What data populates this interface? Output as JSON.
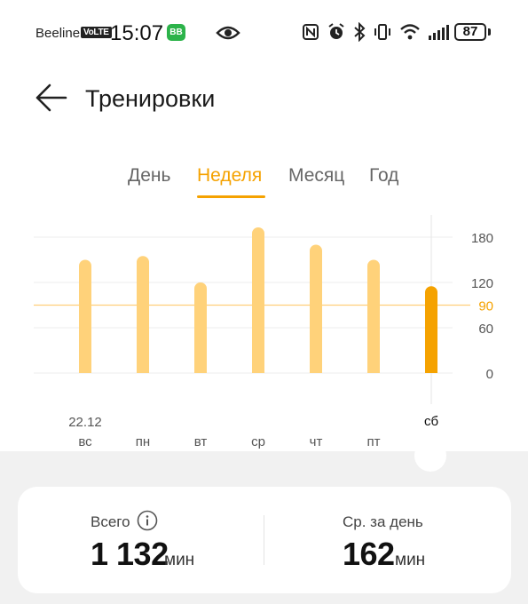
{
  "status_bar": {
    "carrier": "Beeline",
    "volte": "VoLTE",
    "time": "15:07",
    "app_badge": "BB",
    "battery": "87"
  },
  "header": {
    "title": "Тренировки"
  },
  "tabs": [
    {
      "label": "День",
      "active": false
    },
    {
      "label": "Неделя",
      "active": true
    },
    {
      "label": "Месяц",
      "active": false
    },
    {
      "label": "Год",
      "active": false
    }
  ],
  "colors": {
    "accent": "#f5a200",
    "bar": "#ffd27a",
    "bar_selected": "#f5a200",
    "goal_line": "#ffcf7a",
    "grid": "#eeeeee"
  },
  "chart_data": {
    "type": "bar",
    "categories": [
      "вс",
      "пн",
      "вт",
      "ср",
      "чт",
      "пт",
      "сб"
    ],
    "date_label": "22.12",
    "values": [
      150,
      155,
      120,
      193,
      170,
      150,
      115
    ],
    "selected_index": 6,
    "yticks": [
      0,
      60,
      120,
      180
    ],
    "ylim": [
      0,
      200
    ],
    "goal": 90,
    "grid": true
  },
  "summary": {
    "total_label": "Всего",
    "total_value": "1 132",
    "total_unit": "мин",
    "avg_label": "Ср. за день",
    "avg_value": "162",
    "avg_unit": "мин"
  }
}
